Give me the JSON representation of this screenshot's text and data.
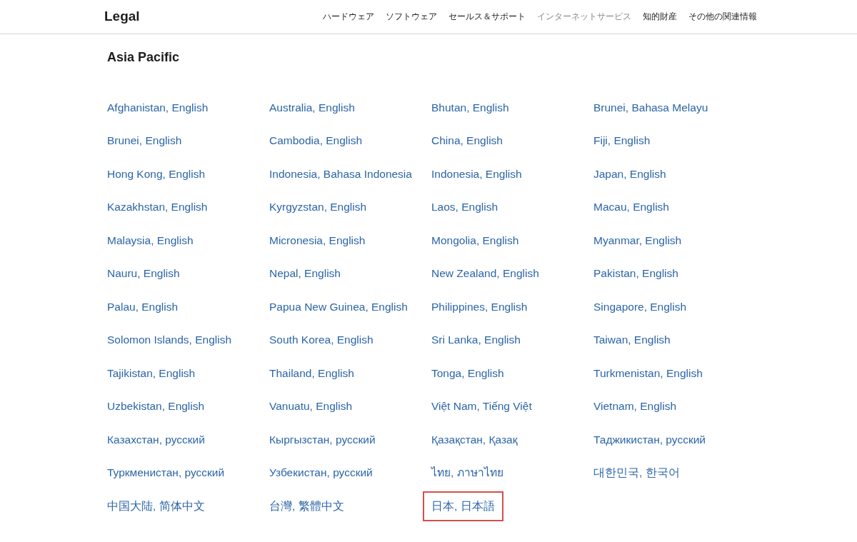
{
  "header": {
    "title": "Legal",
    "nav": [
      {
        "label": "ハードウェア",
        "selected": false
      },
      {
        "label": "ソフトウェア",
        "selected": false
      },
      {
        "label": "セールス＆サポート",
        "selected": false
      },
      {
        "label": "インターネットサービス",
        "selected": true
      },
      {
        "label": "知的財産",
        "selected": false
      },
      {
        "label": "その他の関連情報",
        "selected": false
      }
    ]
  },
  "section": {
    "title": "Asia Pacific",
    "links": [
      {
        "label": "Afghanistan, English",
        "highlighted": false
      },
      {
        "label": "Australia, English",
        "highlighted": false
      },
      {
        "label": "Bhutan, English",
        "highlighted": false
      },
      {
        "label": "Brunei, Bahasa Melayu",
        "highlighted": false
      },
      {
        "label": "Brunei, English",
        "highlighted": false
      },
      {
        "label": "Cambodia, English",
        "highlighted": false
      },
      {
        "label": "China, English",
        "highlighted": false
      },
      {
        "label": "Fiji, English",
        "highlighted": false
      },
      {
        "label": "Hong Kong, English",
        "highlighted": false
      },
      {
        "label": "Indonesia, Bahasa Indonesia",
        "highlighted": false
      },
      {
        "label": "Indonesia, English",
        "highlighted": false
      },
      {
        "label": "Japan, English",
        "highlighted": false
      },
      {
        "label": "Kazakhstan, English",
        "highlighted": false
      },
      {
        "label": "Kyrgyzstan, English",
        "highlighted": false
      },
      {
        "label": "Laos, English",
        "highlighted": false
      },
      {
        "label": "Macau, English",
        "highlighted": false
      },
      {
        "label": "Malaysia, English",
        "highlighted": false
      },
      {
        "label": "Micronesia, English",
        "highlighted": false
      },
      {
        "label": "Mongolia, English",
        "highlighted": false
      },
      {
        "label": "Myanmar, English",
        "highlighted": false
      },
      {
        "label": "Nauru, English",
        "highlighted": false
      },
      {
        "label": "Nepal, English",
        "highlighted": false
      },
      {
        "label": "New Zealand, English",
        "highlighted": false
      },
      {
        "label": "Pakistan, English",
        "highlighted": false
      },
      {
        "label": "Palau, English",
        "highlighted": false
      },
      {
        "label": "Papua New Guinea, English",
        "highlighted": false
      },
      {
        "label": "Philippines, English",
        "highlighted": false
      },
      {
        "label": "Singapore, English",
        "highlighted": false
      },
      {
        "label": "Solomon Islands, English",
        "highlighted": false
      },
      {
        "label": "South Korea, English",
        "highlighted": false
      },
      {
        "label": "Sri Lanka, English",
        "highlighted": false
      },
      {
        "label": "Taiwan, English",
        "highlighted": false
      },
      {
        "label": "Tajikistan, English",
        "highlighted": false
      },
      {
        "label": "Thailand, English",
        "highlighted": false
      },
      {
        "label": "Tonga, English",
        "highlighted": false
      },
      {
        "label": "Turkmenistan, English",
        "highlighted": false
      },
      {
        "label": "Uzbekistan, English",
        "highlighted": false
      },
      {
        "label": "Vanuatu, English",
        "highlighted": false
      },
      {
        "label": "Việt Nam, Tiếng Việt",
        "highlighted": false
      },
      {
        "label": "Vietnam, English",
        "highlighted": false
      },
      {
        "label": "Казахстан, русский",
        "highlighted": false
      },
      {
        "label": "Кыргызстан, русский",
        "highlighted": false
      },
      {
        "label": "Қазақстан, Қазақ",
        "highlighted": false
      },
      {
        "label": "Таджикистан, русский",
        "highlighted": false
      },
      {
        "label": "Туркменистан, русский",
        "highlighted": false
      },
      {
        "label": "Узбекистан, русский",
        "highlighted": false
      },
      {
        "label": "ไทย, ภาษาไทย",
        "highlighted": false
      },
      {
        "label": "대한민국, 한국어",
        "highlighted": false
      },
      {
        "label": "中国大陆, 简体中文",
        "highlighted": false
      },
      {
        "label": "台灣, 繁體中文",
        "highlighted": false
      },
      {
        "label": "日本, 日本語",
        "highlighted": true
      }
    ]
  }
}
